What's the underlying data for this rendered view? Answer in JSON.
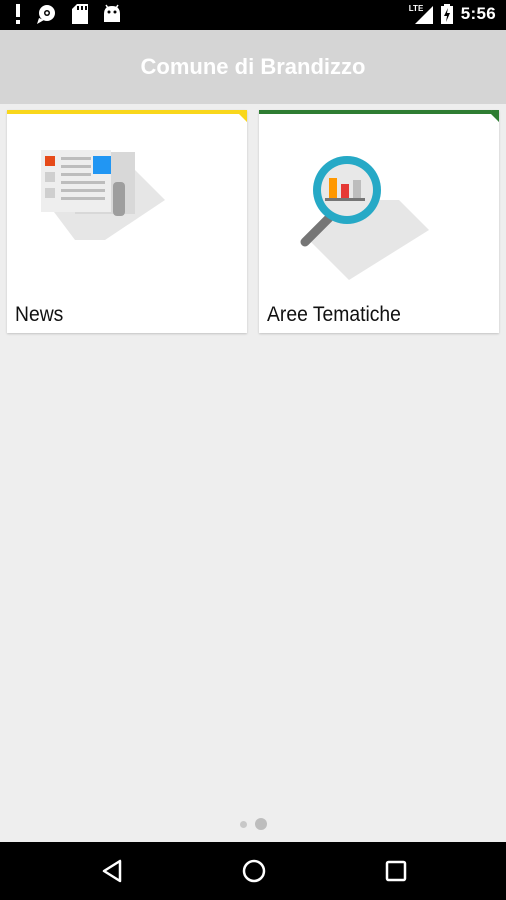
{
  "status_bar": {
    "time": "5:56",
    "network": "LTE",
    "left_icons": [
      "alert-icon",
      "chat-bubble-icon",
      "sd-card-icon",
      "android-icon"
    ],
    "right_icons": [
      "signal-icon",
      "battery-charging-icon"
    ]
  },
  "app_bar": {
    "title": "Comune di Brandizzo",
    "background": "#d5d5d5"
  },
  "tiles": [
    {
      "label": "News",
      "icon": "newspaper-icon",
      "accent_color": "#f9d71c"
    },
    {
      "label": "Aree Tematiche",
      "icon": "magnifier-chart-icon",
      "accent_color": "#2e7d32"
    }
  ],
  "pager": {
    "page_count": 2,
    "current_page": 2
  },
  "nav_bar": {
    "buttons": [
      "back-icon",
      "home-icon",
      "recents-icon"
    ]
  }
}
